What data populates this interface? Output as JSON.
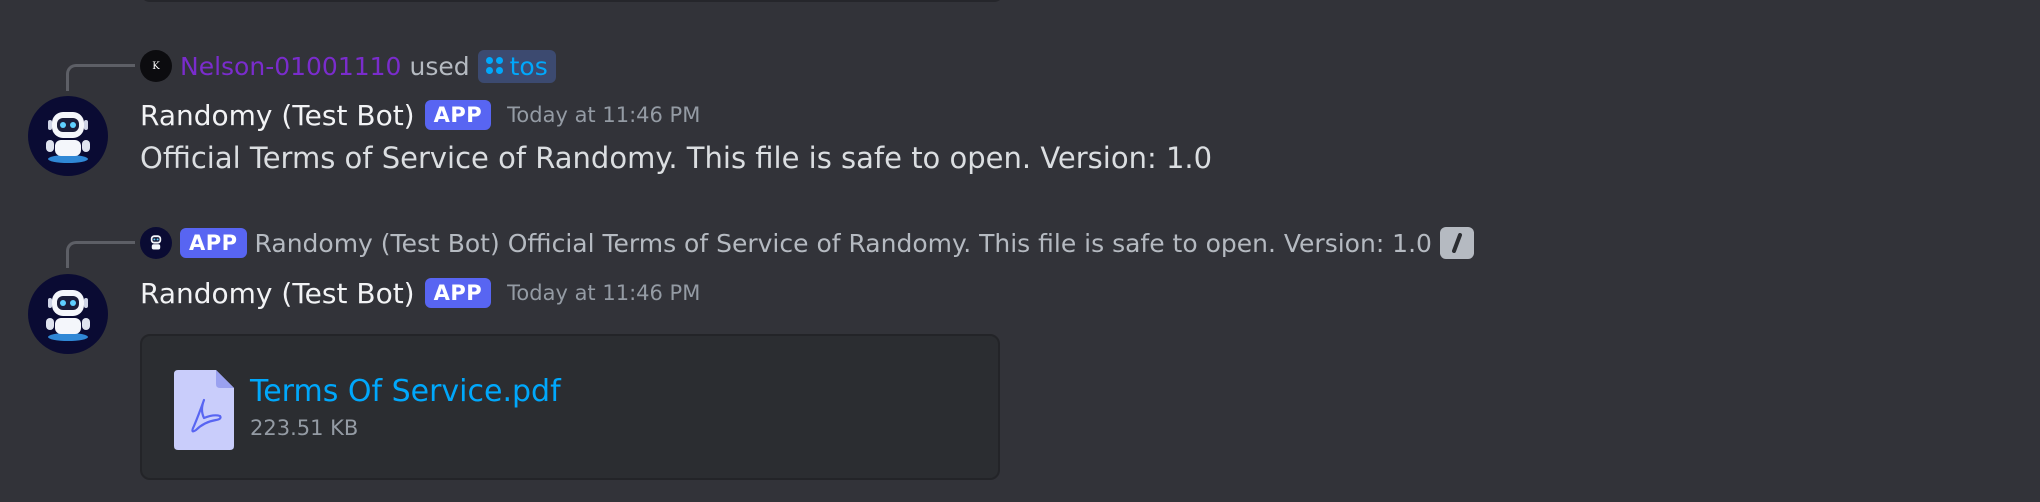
{
  "messages": [
    {
      "reply": {
        "user": "Nelson-01001110",
        "avatar_letter": "K",
        "action": "used",
        "command": "tos"
      },
      "author": "Randomy (Test Bot)",
      "badge": "APP",
      "timestamp": "Today at 11:46 PM",
      "content": "Official Terms of Service of Randomy. This file is safe to open. Version: 1.0"
    },
    {
      "reply": {
        "badge": "APP",
        "user": "Randomy (Test Bot)",
        "content": "Official Terms of Service of Randomy. This file is safe to open. Version: 1.0"
      },
      "author": "Randomy (Test Bot)",
      "badge": "APP",
      "timestamp": "Today at 11:46 PM",
      "attachment": {
        "filename": "Terms Of Service.pdf",
        "size": "223.51 KB"
      }
    }
  ],
  "colors": {
    "background": "#323339",
    "link": "#00a8fc",
    "app_badge": "#5865f2",
    "reply_user": "#7a2ccc"
  }
}
